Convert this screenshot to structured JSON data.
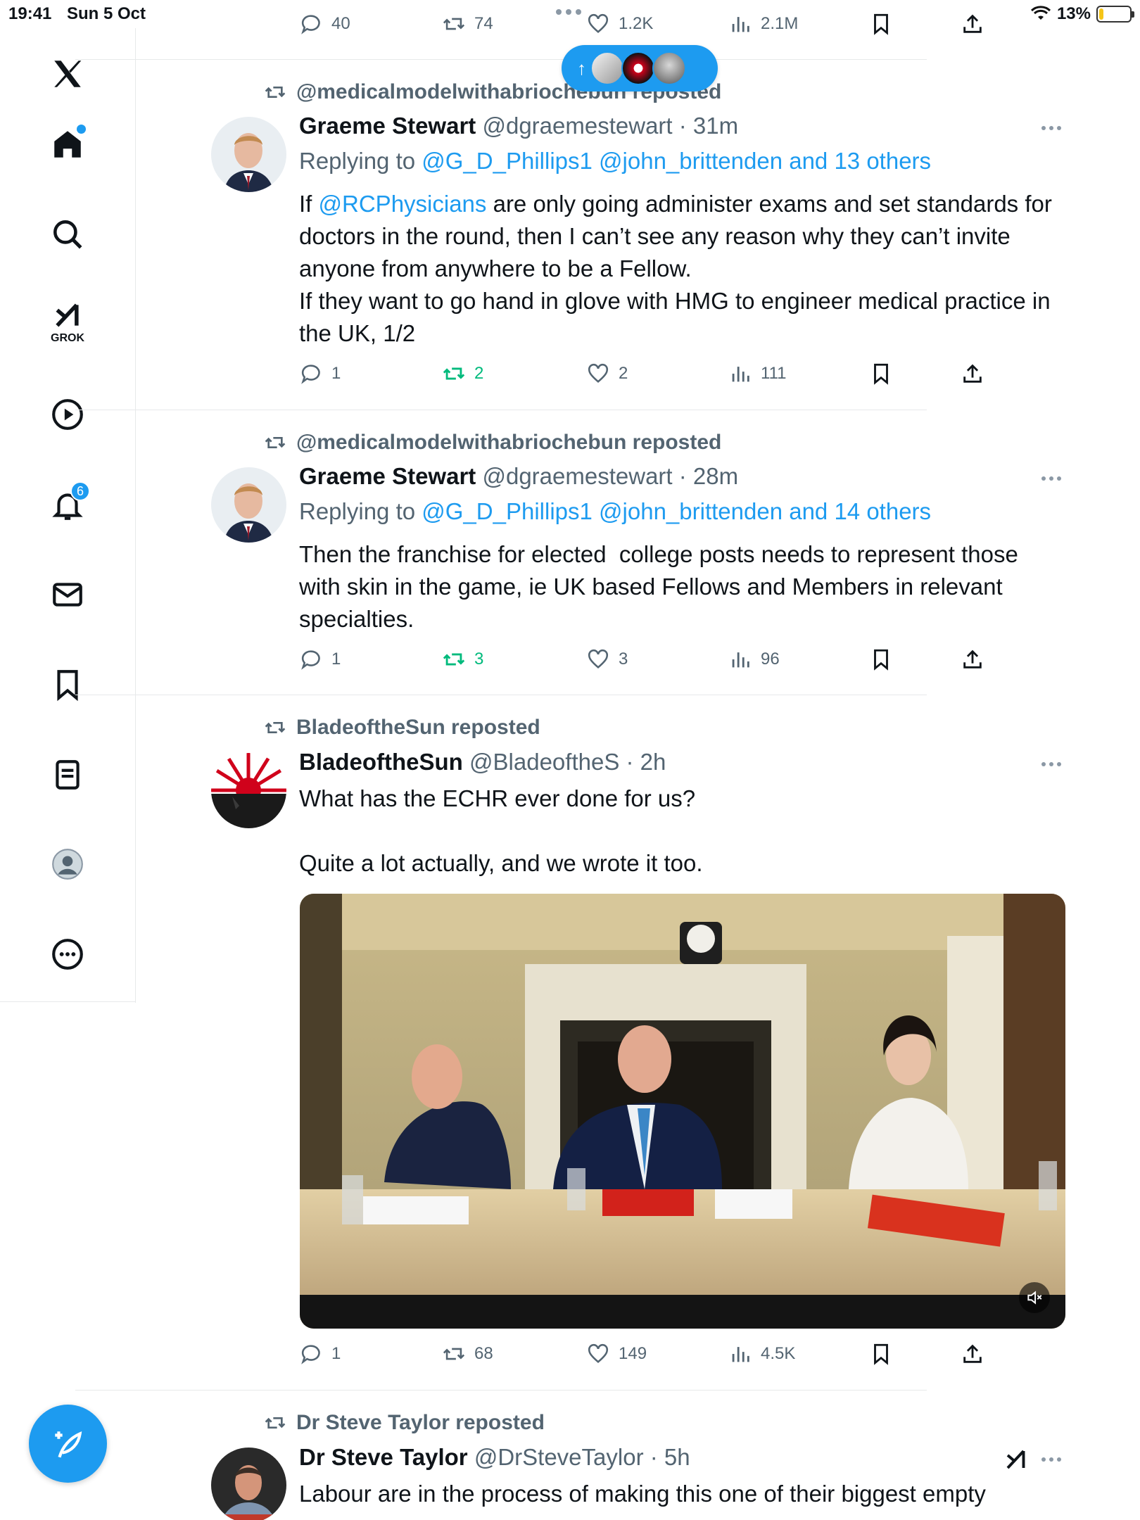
{
  "status_bar": {
    "time": "19:41",
    "date": "Sun 5 Oct",
    "battery": "13%",
    "battery_level": 0.13
  },
  "sidebar": {
    "items": [
      {
        "name": "home",
        "icon": "home-icon"
      },
      {
        "name": "search",
        "icon": "search-icon"
      },
      {
        "name": "grok",
        "icon": "grok-icon",
        "label": "GROK"
      },
      {
        "name": "video",
        "icon": "play-icon"
      },
      {
        "name": "notifications",
        "icon": "bell-icon",
        "badge": "6"
      },
      {
        "name": "messages",
        "icon": "mail-icon"
      },
      {
        "name": "bookmarks",
        "icon": "bookmark-icon"
      },
      {
        "name": "lists",
        "icon": "list-icon"
      },
      {
        "name": "profile",
        "icon": "profile-icon"
      },
      {
        "name": "more",
        "icon": "more-icon"
      }
    ]
  },
  "colors": {
    "accent": "#1d9bf0",
    "repost_green": "#00ba7c",
    "muted": "#536471"
  },
  "top_actions": {
    "replies": "40",
    "reposts": "74",
    "likes": "1.2K",
    "views": "2.1M"
  },
  "pill_arrow": "↑",
  "posts": [
    {
      "repost_by": "@medicalmodelwithabriochebun reposted",
      "name": "Graeme Stewart",
      "handle": "@dgraemestewart",
      "time": "· 31m",
      "reply_prefix": "Replying to ",
      "reply_to": "@G_D_Phillips1 @john_brittenden and 13 others",
      "body_prefix": "If ",
      "body_mention": "@RCPhysicians",
      "body_rest": " are only going administer exams and set standards for doctors in the round, then I can’t see any reason why they can’t invite anyone from anywhere to be a Fellow.\nIf they want to go hand in glove with HMG to engineer medical practice in the UK, 1/2",
      "replies": "1",
      "reposts": "2",
      "likes": "2",
      "views": "111"
    },
    {
      "repost_by": "@medicalmodelwithabriochebun reposted",
      "name": "Graeme Stewart",
      "handle": "@dgraemestewart",
      "time": "· 28m",
      "reply_prefix": "Replying to ",
      "reply_to": "@G_D_Phillips1 @john_brittenden and 14 others",
      "body": "Then the franchise for elected  college posts needs to represent those with skin in the game, ie UK based Fellows and Members in relevant specialties.",
      "replies": "1",
      "reposts": "3",
      "likes": "3",
      "views": "96"
    },
    {
      "repost_by": "BladeoftheSun reposted",
      "name": "BladeoftheSun",
      "handle": "@BladeoftheS",
      "time": "· 2h",
      "body": "What has the ECHR ever done for us?\n\nQuite a lot actually, and we wrote it too.",
      "replies": "1",
      "reposts": "68",
      "likes": "149",
      "views": "4.5K"
    },
    {
      "repost_by": "Dr Steve Taylor reposted",
      "name": "Dr Steve Taylor",
      "handle": "@DrSteveTaylor",
      "time": "· 5h",
      "body": "Labour are in the process of making this one of their biggest empty"
    }
  ]
}
